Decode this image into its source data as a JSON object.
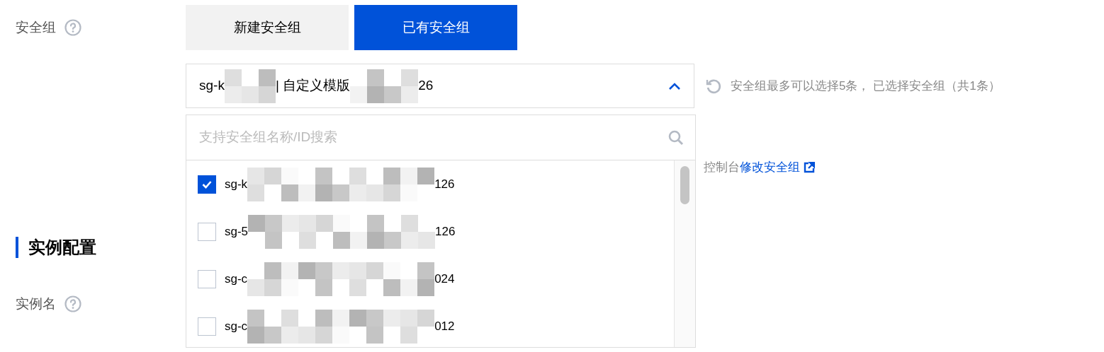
{
  "security_group": {
    "label": "安全组",
    "toggle": [
      {
        "label": "新建安全组",
        "selected": false
      },
      {
        "label": "已有安全组",
        "selected": true
      }
    ],
    "select": {
      "value_prefix": "sg-k",
      "value_middle": "| 自定义模版",
      "value_suffix": "26",
      "expanded": true
    },
    "hint": "安全组最多可以选择5条， 已选择安全组（共1条）",
    "note_text": "控制台",
    "note_link": "修改安全组"
  },
  "dropdown": {
    "search": {
      "placeholder": "支持安全组名称/ID搜索"
    },
    "options": [
      {
        "prefix": "sg-k",
        "suffix": "126",
        "checked": true
      },
      {
        "prefix": "sg-5",
        "suffix": "126",
        "checked": false
      },
      {
        "prefix": "sg-c",
        "suffix": "024",
        "checked": false
      },
      {
        "prefix": "sg-c",
        "suffix": "012",
        "checked": false
      }
    ]
  },
  "section": {
    "title": "实例配置"
  },
  "instance_name": {
    "label": "实例名"
  }
}
